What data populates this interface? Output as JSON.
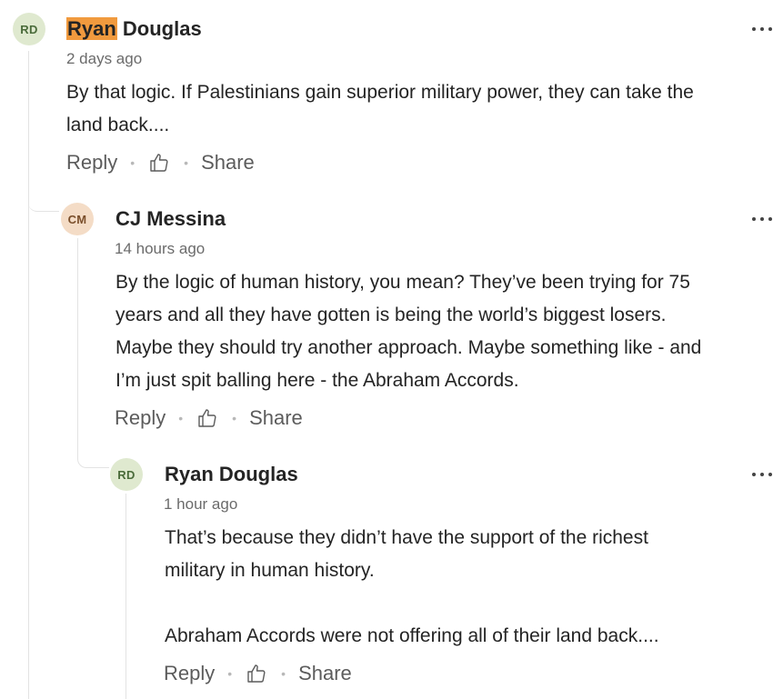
{
  "comments": [
    {
      "initials": "RD",
      "avatar_bg": "#dfe9cf",
      "avatar_fg": "#4a6b3a",
      "author_highlight": "Ryan",
      "author_rest": " Douglas",
      "timestamp": "2 days ago",
      "body": [
        "By that logic. If Palestinians gain superior military power, they can take the",
        "land back...."
      ],
      "reply_label": "Reply",
      "share_label": "Share",
      "like_icon": "thumbs-up-icon",
      "more_icon": "more-options-icon"
    },
    {
      "initials": "CM",
      "avatar_bg": "#f4dcc6",
      "avatar_fg": "#7a4e2a",
      "author": "CJ Messina",
      "timestamp": "14 hours ago",
      "body": [
        "By the logic of human history, you mean?  They’ve been trying for 75",
        "years and all they have gotten is being the world’s biggest losers.",
        "Maybe they should try another approach.  Maybe something like - and",
        "I’m just spit balling here - the Abraham Accords."
      ],
      "reply_label": "Reply",
      "share_label": "Share",
      "like_icon": "thumbs-up-icon",
      "more_icon": "more-options-icon"
    },
    {
      "initials": "RD",
      "avatar_bg": "#dfe9cf",
      "avatar_fg": "#4a6b3a",
      "author": "Ryan Douglas",
      "timestamp": "1 hour ago",
      "body": [
        "That’s because they didn’t have the support of the richest",
        "military in human history.",
        "",
        "Abraham Accords were not offering all of their land back...."
      ],
      "reply_label": "Reply",
      "share_label": "Share",
      "like_icon": "thumbs-up-icon",
      "more_icon": "more-options-icon"
    }
  ],
  "colors": {
    "highlight": "#f19a3e",
    "thread_line": "#e3e3e3",
    "text": "#242424",
    "muted": "#6b6b6b"
  }
}
